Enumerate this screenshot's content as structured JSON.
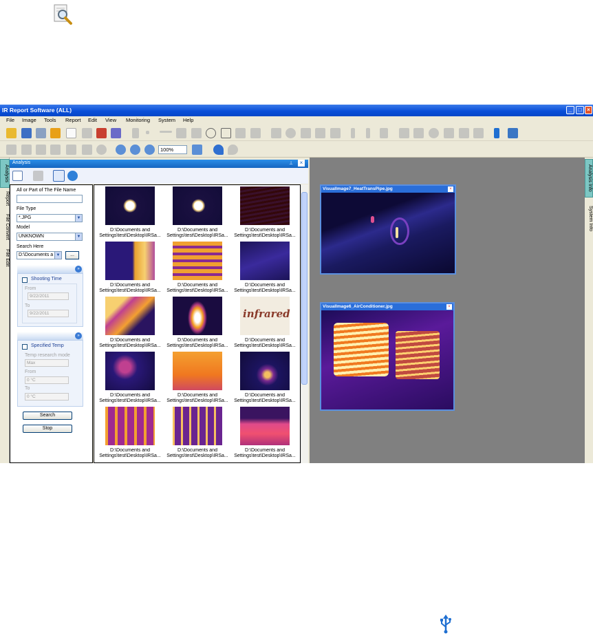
{
  "window": {
    "title": "IR Report Software (ALL)"
  },
  "menu": [
    "File",
    "Image",
    "Tools",
    "Report",
    "Edit",
    "View",
    "Monitoring",
    "System",
    "Help"
  ],
  "toolbar": {
    "zoom_value": "100%"
  },
  "left_tabs": [
    "Analysis",
    "Report",
    "File Convert",
    "File Edit"
  ],
  "right_tabs": [
    "Analysis Info",
    "System Info"
  ],
  "panel": {
    "title": "Analysis"
  },
  "form": {
    "file_name_label": "All or Part of The File Name",
    "file_name_value": "",
    "file_type_label": "File Type",
    "file_type_value": "*.JPG",
    "model_label": "Model",
    "model_value": "UNKNOWN",
    "search_here_label": "Search Here",
    "search_here_value": "D:\\Documents a",
    "browse_label": "...",
    "shooting_time": {
      "label": "Shooting Time",
      "from_label": "From",
      "from_value": "9/22/2011",
      "to_label": "To",
      "to_value": "9/22/2011"
    },
    "specified_temp": {
      "label": "Specified Temp",
      "mode_label": "Temp research mode",
      "mode_value": "Max",
      "from_label": "From",
      "from_value": "0 °C",
      "to_label": "To",
      "to_value": "0 °C"
    },
    "search_button": "Search",
    "stop_button": "Stop"
  },
  "thumbnails": {
    "caption_line1": "D:\\Documents and",
    "caption_line2": "Settings\\test\\Desktop\\IRSa..."
  },
  "viewers": [
    {
      "title": "VisualImage7_HeatTransPipe.jpg"
    },
    {
      "title": "VisualImage6_AirConditioner.jpg"
    }
  ],
  "thumb_images": {
    "infrared_text": "infrared"
  }
}
